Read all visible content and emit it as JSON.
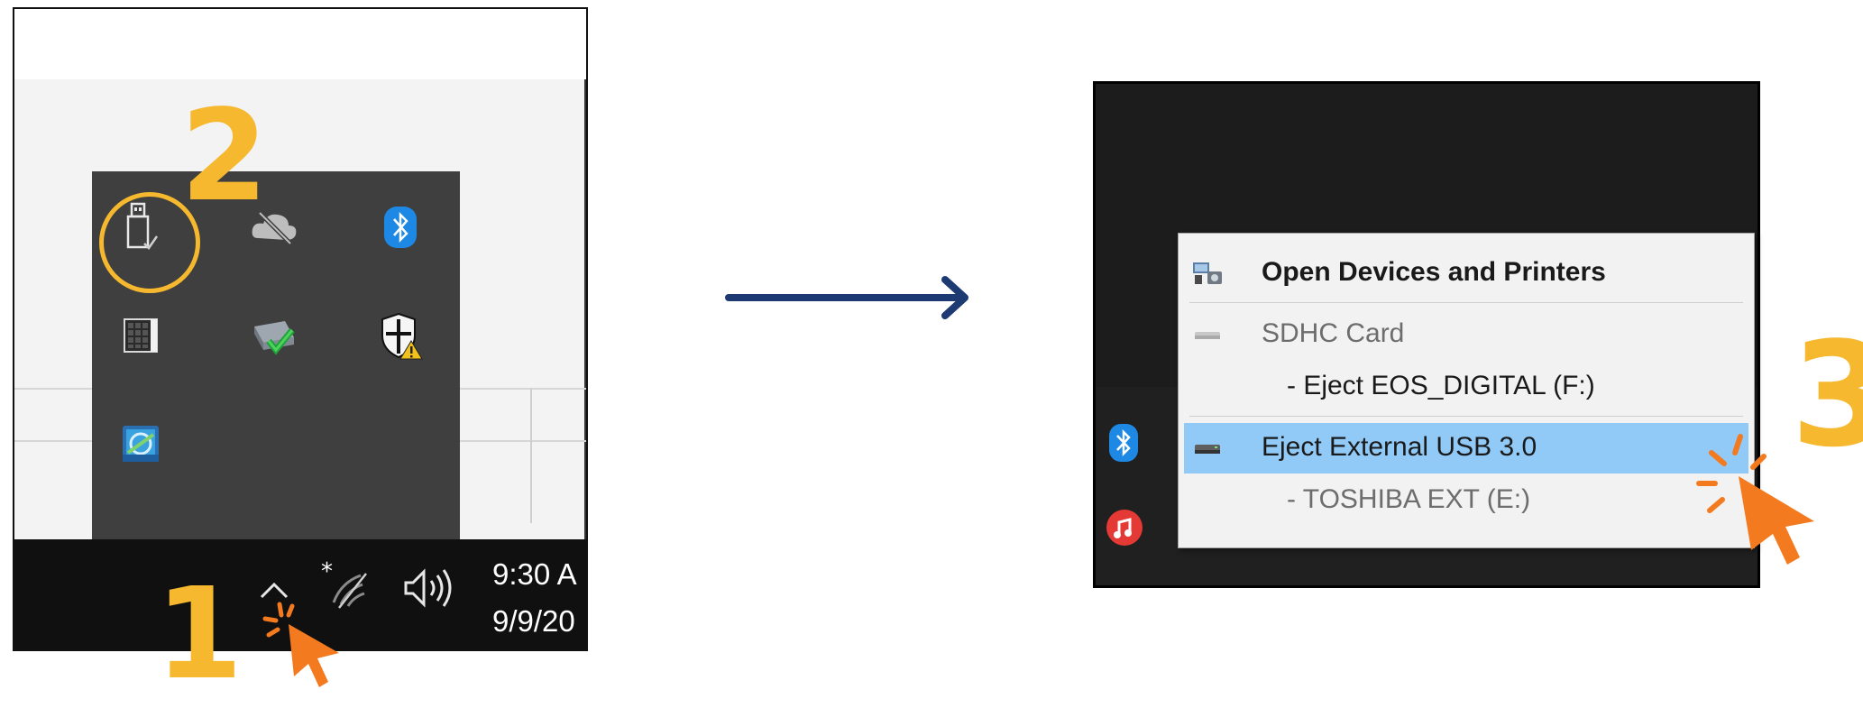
{
  "steps": {
    "one": "1",
    "two": "2",
    "three": "3"
  },
  "taskbar": {
    "time": "9:30 A",
    "date": "9/9/20",
    "show_hidden_icons": "chevron-up-icon",
    "wifi": "wifi-icon",
    "volume": "volume-icon"
  },
  "tray_popup": {
    "icons": [
      "usb-drive-icon",
      "cloud-offline-icon",
      "bluetooth-icon",
      "keyboard-icon",
      "network-check-icon",
      "security-shield-icon",
      "display-settings-icon"
    ]
  },
  "context_menu": {
    "open_devices": "Open Devices and Printers",
    "sdhc_card": "SDHC Card",
    "eject_eos": "-  Eject EOS_DIGITAL (F:)",
    "eject_external": "Eject External USB 3.0",
    "toshiba": "-  TOSHIBA EXT (E:)"
  },
  "colors": {
    "accent": "#f5b82e",
    "cursor": "#f47a20",
    "arrow": "#1e3a72",
    "highlight": "#91c9f7"
  }
}
